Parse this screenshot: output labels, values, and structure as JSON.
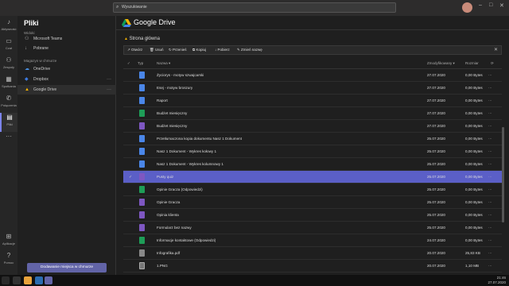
{
  "search": {
    "placeholder": "Wyszukiwanie"
  },
  "rail": [
    {
      "label": "Aktywność",
      "icon": "bell-icon"
    },
    {
      "label": "Czat",
      "icon": "chat-icon"
    },
    {
      "label": "Zespoły",
      "icon": "teams-icon"
    },
    {
      "label": "Spotkania",
      "icon": "calendar-icon"
    },
    {
      "label": "Połączenia",
      "icon": "phone-icon"
    },
    {
      "label": "Pliki",
      "icon": "file-icon"
    },
    {
      "label": "Aplikacje",
      "icon": "apps-icon"
    },
    {
      "label": "Pomoc",
      "icon": "help-icon"
    }
  ],
  "files": {
    "title": "Pliki",
    "section_views": "Widoki",
    "views": [
      "Microsoft Teams",
      "Pobrane"
    ],
    "section_storage": "Magazyn w chmurze",
    "storage": [
      "OneDrive",
      "Dropbox",
      "Google Drive"
    ],
    "add_label": "Dodawanie miejsca w chmurze"
  },
  "drive": {
    "title": "Google Drive",
    "breadcrumb": "Strona główna",
    "toolbar": [
      "Otwórz",
      "Usuń",
      "Przenieś",
      "Kopiuj",
      "Pobierz",
      "Zmień nazwę"
    ],
    "columns": {
      "type": "Typ",
      "name": "Nazwa",
      "modified": "Zmodyfikowany",
      "size": "Rozmiar"
    },
    "rows": [
      {
        "kind": "doc",
        "name": "Życiorys - motyw szwajcarski",
        "date": "27.07.2020",
        "size": "0,00 Bytes"
      },
      {
        "kind": "doc",
        "name": "Esej - motyw broszury",
        "date": "27.07.2020",
        "size": "0,00 Bytes"
      },
      {
        "kind": "doc",
        "name": "Raport",
        "date": "27.07.2020",
        "size": "0,00 Bytes"
      },
      {
        "kind": "sheet",
        "name": "Budżet miesięczny",
        "date": "27.07.2020",
        "size": "0,00 Bytes"
      },
      {
        "kind": "form",
        "name": "Budżet miesięczny",
        "date": "27.07.2020",
        "size": "0,00 Bytes"
      },
      {
        "kind": "doc",
        "name": "Przetłumaczona kopia dokumentu Nasz 1 Dokument",
        "date": "25.07.2020",
        "size": "0,00 Bytes"
      },
      {
        "kind": "doc",
        "name": "Nasz 1 Dokument - Wykres kołowy 1",
        "date": "25.07.2020",
        "size": "0,00 Bytes"
      },
      {
        "kind": "doc",
        "name": "Nasz 1 Dokument - Wykres kolumnowy 1",
        "date": "25.07.2020",
        "size": "0,00 Bytes"
      },
      {
        "kind": "form",
        "name": "Pusty quiz",
        "date": "25.07.2020",
        "size": "0,00 Bytes"
      },
      {
        "kind": "sheet",
        "name": "Opinie Gracza (Odpowiedzi)",
        "date": "25.07.2020",
        "size": "0,00 Bytes"
      },
      {
        "kind": "form",
        "name": "Opinie Gracza",
        "date": "25.07.2020",
        "size": "0,00 Bytes"
      },
      {
        "kind": "form",
        "name": "Opinia klienta",
        "date": "25.07.2020",
        "size": "0,00 Bytes"
      },
      {
        "kind": "form",
        "name": "Formularz bez nazwy",
        "date": "25.07.2020",
        "size": "0,00 Bytes"
      },
      {
        "kind": "sheet",
        "name": "Informacje kontaktowe (Odpowiedzi)",
        "date": "24.07.2020",
        "size": "0,00 Bytes"
      },
      {
        "kind": "pdf",
        "name": "Infografika.pdf",
        "date": "20.07.2020",
        "size": "25,83 KB"
      },
      {
        "kind": "png",
        "name": "1.PNG",
        "date": "20.07.2020",
        "size": "1,10 MB"
      }
    ],
    "selected_index": 8
  },
  "clock": {
    "time": "21:46",
    "date": "27.07.2020"
  }
}
